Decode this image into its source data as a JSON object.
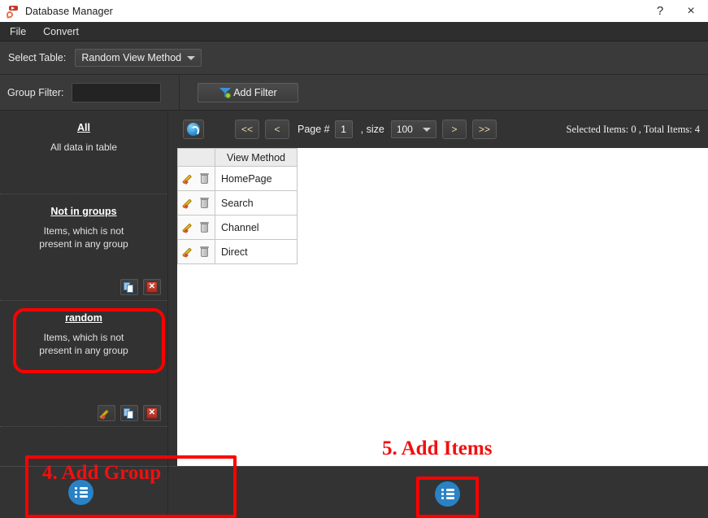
{
  "window": {
    "title": "Database Manager",
    "app_icon": "database-manager-logo-icon",
    "help_label": "?",
    "close_label": "×"
  },
  "menubar": {
    "items": [
      {
        "label": "File"
      },
      {
        "label": "Convert"
      }
    ]
  },
  "select_table": {
    "label": "Select Table:",
    "value": "Random View Method",
    "caret_icon": "chevron-down-icon"
  },
  "group_filter": {
    "label": "Group Filter:",
    "value": "",
    "placeholder": "",
    "add_filter_label": "Add Filter",
    "add_filter_icon": "funnel-icon"
  },
  "sidebar": {
    "groups": [
      {
        "title": "All",
        "description": "All data in table",
        "actions": []
      },
      {
        "title": "Not in groups",
        "description": "Items, which is not present in any group",
        "actions": [
          "copy",
          "delete"
        ]
      },
      {
        "title": "random",
        "description": "Items, which is not present in any group",
        "actions": [
          "edit",
          "copy",
          "delete"
        ]
      }
    ],
    "add_group_button_icon": "list-icon"
  },
  "toolbar": {
    "refresh_icon": "refresh-icon",
    "first_label": "<<",
    "prev_label": "<",
    "page_label": "Page #",
    "page_value": "1",
    "size_label": ", size",
    "size_value": "100",
    "size_caret_icon": "chevron-down-icon",
    "next_label": ">",
    "last_label": ">>",
    "counts_text": "Selected Items: 0 , Total Items: 4"
  },
  "table": {
    "icons_header": "",
    "columns": [
      "View Method"
    ],
    "rows": [
      {
        "value": "HomePage",
        "edit_icon": "pencil-icon",
        "delete_icon": "trash-icon"
      },
      {
        "value": "Search",
        "edit_icon": "pencil-icon",
        "delete_icon": "trash-icon"
      },
      {
        "value": "Channel",
        "edit_icon": "pencil-icon",
        "delete_icon": "trash-icon"
      },
      {
        "value": "Direct",
        "edit_icon": "pencil-icon",
        "delete_icon": "trash-icon"
      }
    ]
  },
  "bottom": {
    "add_items_button_icon": "list-icon"
  },
  "annotations": [
    {
      "id": "step-4",
      "text": "4. Add Group",
      "color": "#ff0000"
    },
    {
      "id": "step-5",
      "text": "5. Add Items",
      "color": "#ff0000"
    },
    {
      "id": "highlight-random",
      "text": "",
      "color": "#ff0000"
    }
  ]
}
